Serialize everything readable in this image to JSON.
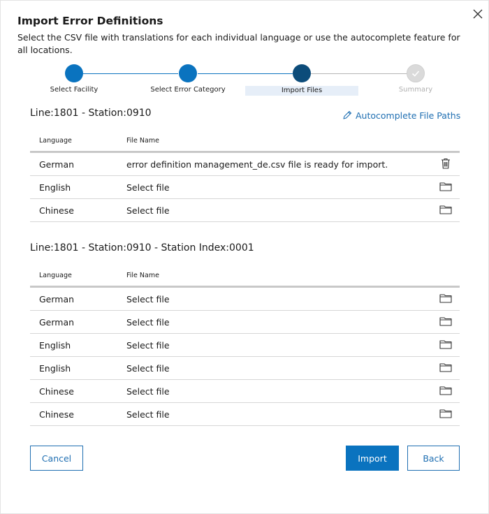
{
  "dialog": {
    "title": "Import Error Definitions",
    "subtitle": "Select the CSV file with translations for each individual language or use the autocomplete feature for all locations.",
    "close_icon": "close-icon"
  },
  "stepper": {
    "steps": [
      {
        "label": "Select Facility",
        "state": "completed",
        "color": "#0a73bf"
      },
      {
        "label": "Select Error Category",
        "state": "completed",
        "color": "#0a73bf"
      },
      {
        "label": "Import Files",
        "state": "active",
        "color": "#0c4c7a"
      },
      {
        "label": "Summary",
        "state": "pending",
        "color": "#dadada"
      }
    ]
  },
  "autocomplete_label": "Autocomplete File Paths",
  "sections": [
    {
      "title": "Line:1801 - Station:0910",
      "headers": {
        "language": "Language",
        "file": "File Name"
      },
      "rows": [
        {
          "language": "German",
          "file": "error definition management_de.csv file is ready for import.",
          "action": "trash-icon"
        },
        {
          "language": "English",
          "file": "Select file",
          "action": "folder-icon"
        },
        {
          "language": "Chinese",
          "file": "Select file",
          "action": "folder-icon"
        }
      ]
    },
    {
      "title": "Line:1801 - Station:0910 - Station Index:0001",
      "headers": {
        "language": "Language",
        "file": "File Name"
      },
      "rows": [
        {
          "language": "German",
          "file": "Select file",
          "action": "folder-icon"
        },
        {
          "language": "German",
          "file": "Select file",
          "action": "folder-icon"
        },
        {
          "language": "English",
          "file": "Select file",
          "action": "folder-icon"
        },
        {
          "language": "English",
          "file": "Select file",
          "action": "folder-icon"
        },
        {
          "language": "Chinese",
          "file": "Select file",
          "action": "folder-icon"
        },
        {
          "language": "Chinese",
          "file": "Select file",
          "action": "folder-icon"
        }
      ]
    }
  ],
  "buttons": {
    "cancel": "Cancel",
    "import": "Import",
    "back": "Back"
  },
  "colors": {
    "accent": "#0a73bf",
    "active_step": "#0c4c7a",
    "link": "#1f6fb2"
  }
}
